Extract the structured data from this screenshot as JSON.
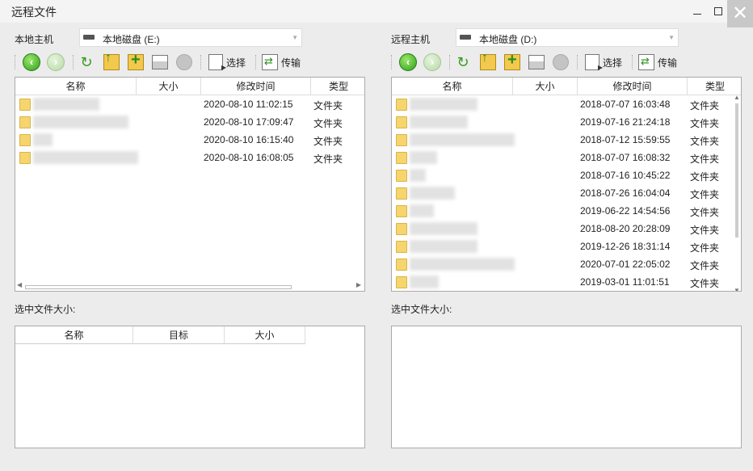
{
  "window": {
    "title": "远程文件",
    "close_glyph": "✕"
  },
  "local": {
    "host_label": "本地主机",
    "drive": "本地磁盘 (E:)",
    "toolbar": {
      "select_label": "选择",
      "transfer_label": "传输"
    },
    "columns": [
      "名称",
      "大小",
      "修改时间",
      "类型"
    ],
    "rows": [
      {
        "date": "2020-08-10 11:02:15",
        "type": "文件夹"
      },
      {
        "date": "2020-08-10 17:09:47",
        "type": "文件夹"
      },
      {
        "date": "2020-08-10 16:15:40",
        "type": "文件夹"
      },
      {
        "date": "2020-08-10 16:08:05",
        "type": "文件夹"
      }
    ],
    "selected_size_label": "选中文件大小:",
    "queue_columns": [
      "名称",
      "目标",
      "大小"
    ]
  },
  "remote": {
    "host_label": "远程主机",
    "drive": "本地磁盘 (D:)",
    "toolbar": {
      "select_label": "选择",
      "transfer_label": "传输"
    },
    "columns": [
      "名称",
      "大小",
      "修改时间",
      "类型"
    ],
    "rows": [
      {
        "date": "2018-07-07 16:03:48",
        "type": "文件夹"
      },
      {
        "date": "2019-07-16 21:24:18",
        "type": "文件夹"
      },
      {
        "date": "2018-07-12 15:59:55",
        "type": "文件夹"
      },
      {
        "date": "2018-07-07 16:08:32",
        "type": "文件夹"
      },
      {
        "date": "2018-07-16 10:45:22",
        "type": "文件夹"
      },
      {
        "date": "2018-07-26 16:04:04",
        "type": "文件夹"
      },
      {
        "date": "2019-06-22 14:54:56",
        "type": "文件夹"
      },
      {
        "date": "2018-08-20 20:28:09",
        "type": "文件夹"
      },
      {
        "date": "2019-12-26 18:31:14",
        "type": "文件夹"
      },
      {
        "date": "2020-07-01 22:05:02",
        "type": "文件夹"
      },
      {
        "date": "2019-03-01 11:01:51",
        "type": "文件夹"
      }
    ],
    "selected_size_label": "选中文件大小:"
  }
}
